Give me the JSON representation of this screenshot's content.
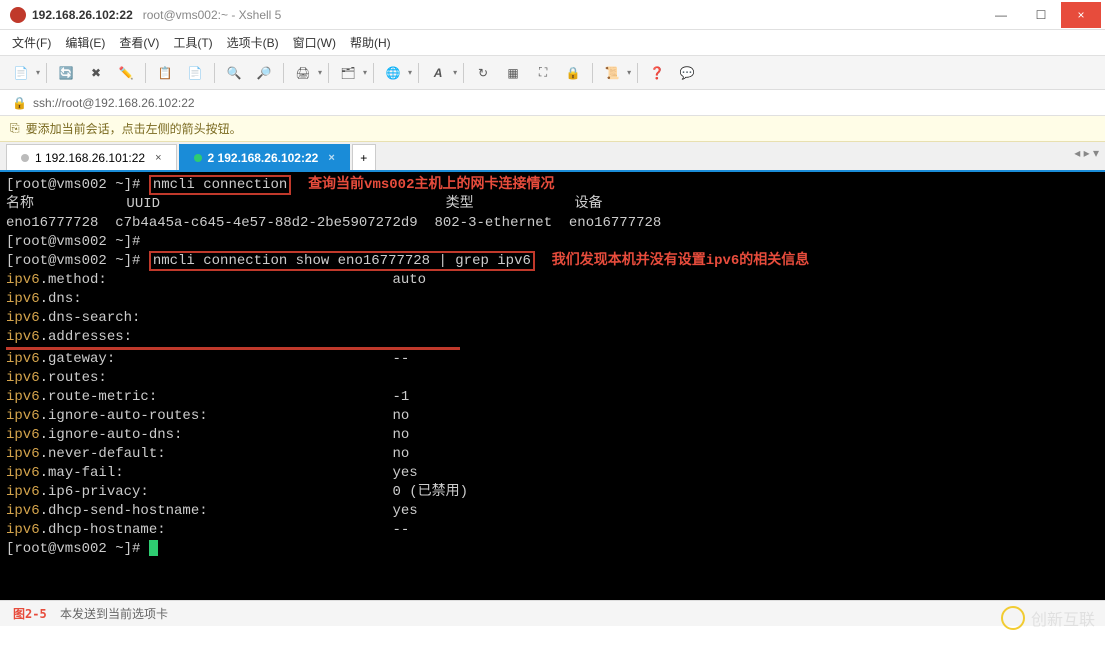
{
  "window": {
    "title_main": "192.168.26.102:22",
    "title_sub": "root@vms002:~ - Xshell 5",
    "min": "—",
    "max": "☐",
    "close": "×"
  },
  "menu": [
    "文件(F)",
    "编辑(E)",
    "查看(V)",
    "工具(T)",
    "选项卡(B)",
    "窗口(W)",
    "帮助(H)"
  ],
  "address": {
    "lock": "🔒",
    "url": "ssh://root@192.168.26.102:22"
  },
  "info": {
    "icon": "⎘",
    "text": "要添加当前会话，点击左侧的箭头按钮。"
  },
  "tabs": [
    {
      "label": "1 192.168.26.101:22",
      "active": false,
      "dot": "gray"
    },
    {
      "label": "2 192.168.26.102:22",
      "active": true,
      "dot": "green"
    }
  ],
  "terminal": {
    "prompt": "[root@vms002 ~]#",
    "cmd1": "nmcli connection",
    "note1": "查询当前vms002主机上的网卡连接情况",
    "hdr": "名称           UUID                                  类型            设备",
    "row": "eno16777728  c7b4a45a-c645-4e57-88d2-2be5907272d9  802-3-ethernet  eno16777728",
    "cmd2": "nmcli connection show eno16777728 | grep ipv6",
    "note2": "我们发现本机并没有设置ipv6的相关信息",
    "props": [
      {
        "k": "ipv6",
        "s": ".method:",
        "v": "auto"
      },
      {
        "k": "ipv6",
        "s": ".dns:",
        "v": ""
      },
      {
        "k": "ipv6",
        "s": ".dns-search:",
        "v": ""
      },
      {
        "k": "ipv6",
        "s": ".addresses:",
        "v": ""
      },
      {
        "k": "ipv6",
        "s": ".gateway:",
        "v": "--"
      },
      {
        "k": "ipv6",
        "s": ".routes:",
        "v": ""
      },
      {
        "k": "ipv6",
        "s": ".route-metric:",
        "v": "-1"
      },
      {
        "k": "ipv6",
        "s": ".ignore-auto-routes:",
        "v": "no"
      },
      {
        "k": "ipv6",
        "s": ".ignore-auto-dns:",
        "v": "no"
      },
      {
        "k": "ipv6",
        "s": ".never-default:",
        "v": "no"
      },
      {
        "k": "ipv6",
        "s": ".may-fail:",
        "v": "yes"
      },
      {
        "k": "ipv6",
        "s": ".ip6-privacy:",
        "v": "0 (已禁用)"
      },
      {
        "k": "ipv6",
        "s": ".dhcp-send-hostname:",
        "v": "yes"
      },
      {
        "k": "ipv6",
        "s": ".dhcp-hostname:",
        "v": "--"
      }
    ],
    "figure": "图2-5"
  },
  "status": {
    "text": "本发送到当前选项卡"
  },
  "watermark": "创新互联"
}
